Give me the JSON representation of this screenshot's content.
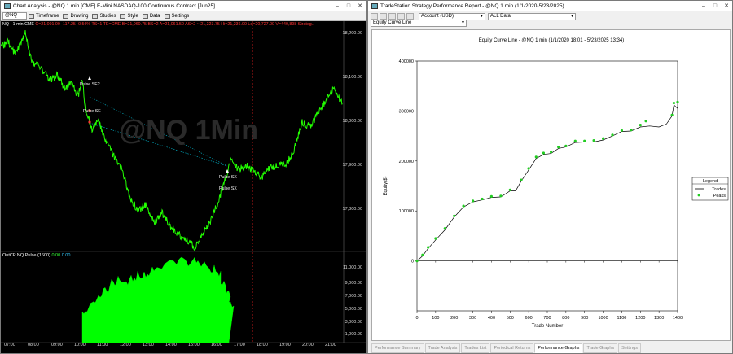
{
  "left": {
    "title": "Chart Analysis - @NQ 1 min [CME] E-Mini NASDAQ-100 Continuous Contract [Jun25]",
    "symbol": "@NQ",
    "toolbar": [
      "Timeframe",
      "Drawing",
      "Studies",
      "Style",
      "Data",
      "Settings"
    ],
    "info_prefix": "NQ - 1 min CME",
    "info_line": "C=21,091.00  -117.25  -0.56%  TS=1  TE=CME  B=21,060.75  BS=2  A=21,061.50  AS=2  ~ 21,223.75  Hi=21,236.00  Lo=20,727.00  V=440,898  Strateg..",
    "watermark": "@NQ 1Min",
    "price_labels": [
      "18,200.00",
      "18,100.00",
      "18,000.00",
      "17,900.00",
      "17,800.00"
    ],
    "indicator_label": "OutCP NQ Pulse (1600)",
    "indicator_v1": "0.00",
    "indicator_v2": "0.00",
    "indicator_labels": [
      "11,000.00",
      "9,000.00",
      "7,000.00",
      "5,000.00",
      "3,000.00",
      "1,000.00"
    ],
    "time_labels": [
      "07:00",
      "08:00",
      "09:00",
      "10:00",
      "11:00",
      "12:00",
      "13:00",
      "14:00",
      "15:00",
      "16:00",
      "17:00",
      "18:00",
      "19:00",
      "20:00",
      "21:00"
    ],
    "annotations": {
      "pulse_se2": "Pulse SE2",
      "pulse_se": "Pulse SE",
      "pulse_sx1": "Pulse SX",
      "pulse_sx2": "Pulse SX"
    },
    "colors": {
      "price": "#22ff00",
      "indicator": "#00ff00",
      "trend_line": "#00bcd4",
      "vline": "#ff2222"
    }
  },
  "right": {
    "title": "TradeStation Strategy Performance Report - @NQ 1 min (1/1/2020-5/23/2025)",
    "account": "Account (USD)",
    "data_range": "ALL Data",
    "graph_type": "Equity Curve Line",
    "tabs": [
      "Performance Summary",
      "Trade Analysis",
      "Trades List",
      "Periodical Returns",
      "Performance Graphs",
      "Trade Graphs",
      "Settings"
    ],
    "active_tab": "Performance Graphs"
  },
  "chart_data": {
    "type": "line",
    "title": "Equity Curve Line - @NQ 1 min (1/1/2020 18:01 - 5/23/2025 13:34)",
    "xlabel": "Trade Number",
    "ylabel": "Equity($)",
    "xlim": [
      0,
      1400
    ],
    "ylim": [
      -100000,
      400000
    ],
    "xticks": [
      0,
      100,
      200,
      300,
      400,
      500,
      600,
      700,
      800,
      900,
      1000,
      1100,
      1200,
      1300,
      1400
    ],
    "yticks": [
      0,
      100000,
      200000,
      300000,
      400000
    ],
    "ytick_labels": [
      "0",
      "100000",
      "200000",
      "300000",
      "400000"
    ],
    "legend": {
      "title": "Legend",
      "position": "right"
    },
    "series": [
      {
        "name": "Trades",
        "color": "#000000",
        "x": [
          0,
          30,
          60,
          100,
          150,
          200,
          250,
          300,
          350,
          400,
          450,
          500,
          530,
          560,
          600,
          640,
          680,
          720,
          760,
          800,
          850,
          900,
          950,
          1000,
          1050,
          1100,
          1150,
          1200,
          1250,
          1300,
          1340,
          1370,
          1380,
          1400
        ],
        "y": [
          0,
          10000,
          25000,
          42000,
          62000,
          88000,
          108000,
          118000,
          122000,
          127000,
          128000,
          140000,
          140000,
          160000,
          182000,
          205000,
          213000,
          215000,
          225000,
          228000,
          237000,
          238000,
          238000,
          242000,
          250000,
          259000,
          260000,
          268000,
          270000,
          268000,
          274000,
          290000,
          312000,
          305000
        ]
      },
      {
        "name": "Peaks",
        "color": "#22cc22",
        "x": [
          0,
          30,
          60,
          100,
          150,
          200,
          250,
          300,
          350,
          400,
          450,
          500,
          560,
          600,
          640,
          680,
          720,
          760,
          800,
          850,
          900,
          950,
          1000,
          1050,
          1100,
          1150,
          1200,
          1230,
          1370,
          1380,
          1400
        ],
        "y": [
          0,
          12000,
          27000,
          45000,
          65000,
          90000,
          110000,
          120000,
          124000,
          129000,
          130000,
          142000,
          162000,
          185000,
          208000,
          216000,
          218000,
          228000,
          230000,
          240000,
          240000,
          241000,
          245000,
          252000,
          261000,
          262000,
          272000,
          280000,
          292000,
          316000,
          318000
        ]
      }
    ]
  }
}
